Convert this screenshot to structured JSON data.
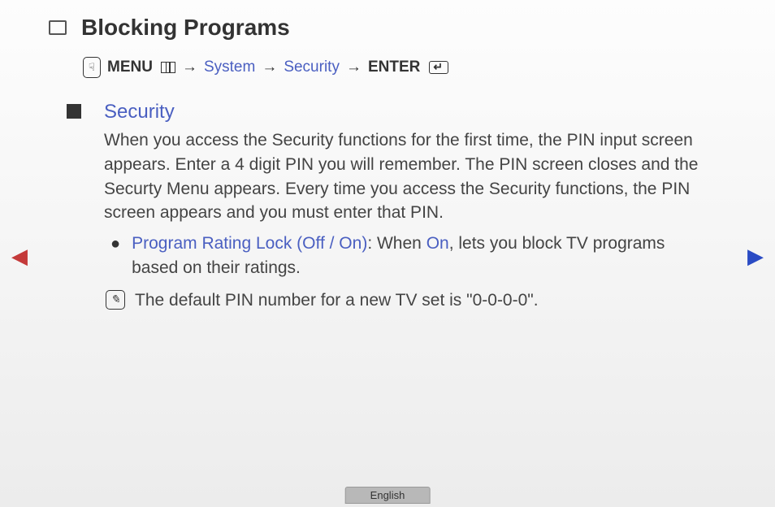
{
  "title": "Blocking Programs",
  "breadcrumb": {
    "menu": "MENU",
    "arrow": "→",
    "system": "System",
    "security": "Security",
    "enter": "ENTER"
  },
  "section": {
    "heading": "Security",
    "paragraph": "When you access the Security functions for the first time, the PIN input screen appears. Enter a 4 digit PIN you will remember. The PIN screen closes and the Securty Menu appears. Every time you access the Security functions, the PIN screen appears and you must enter that PIN.",
    "bullet": {
      "label": "Program Rating Lock (Off / On)",
      "separator": ": When ",
      "on": "On",
      "rest": ", lets you block TV programs based on their ratings."
    },
    "note": "The default PIN number for a new TV set is \"0-0-0-0\"."
  },
  "nav": {
    "left": "◀",
    "right": "▶"
  },
  "language": "English",
  "icons": {
    "hand": "☟",
    "pencil": "✎"
  }
}
